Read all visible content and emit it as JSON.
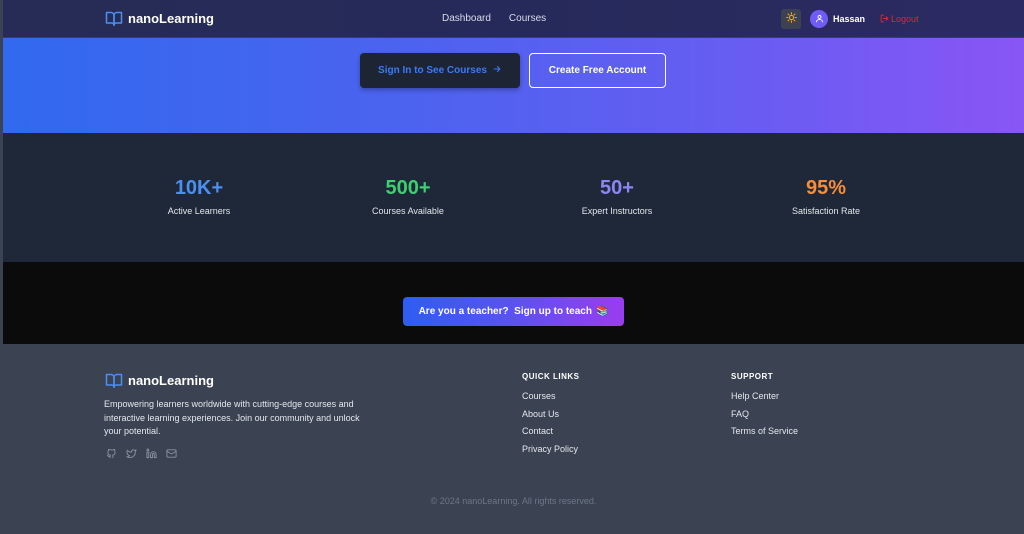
{
  "brand": {
    "name": "nanoLearning"
  },
  "nav": {
    "links": [
      "Dashboard",
      "Courses"
    ],
    "user_name": "Hassan",
    "logout_label": "Logout"
  },
  "hero": {
    "signin_label": "Sign In to See Courses",
    "create_label": "Create Free Account"
  },
  "stats": [
    {
      "value": "10K+",
      "label": "Active Learners",
      "color": "#4a8ff2"
    },
    {
      "value": "500+",
      "label": "Courses Available",
      "color": "#3ecf6f"
    },
    {
      "value": "50+",
      "label": "Expert Instructors",
      "color": "#8b86f5"
    },
    {
      "value": "95%",
      "label": "Satisfaction Rate",
      "color": "#f68d38"
    }
  ],
  "teacher": {
    "label": "Are you a teacher?  Sign up to teach",
    "emoji": "📚"
  },
  "footer": {
    "brand": "nanoLearning",
    "description": "Empowering learners worldwide with cutting-edge courses and interactive learning experiences. Join our community and unlock your potential.",
    "social_icons": [
      "github-icon",
      "twitter-icon",
      "linkedin-icon",
      "mail-icon"
    ],
    "quick_links": {
      "title": "QUICK LINKS",
      "items": [
        "Courses",
        "About Us",
        "Contact",
        "Privacy Policy"
      ]
    },
    "support": {
      "title": "SUPPORT",
      "items": [
        "Help Center",
        "FAQ",
        "Terms of Service"
      ]
    },
    "copyright": "© 2024 nanoLearning. All rights reserved."
  },
  "colors": {
    "accent_blue": "#3c79f4",
    "logout_red": "#e5252a"
  }
}
